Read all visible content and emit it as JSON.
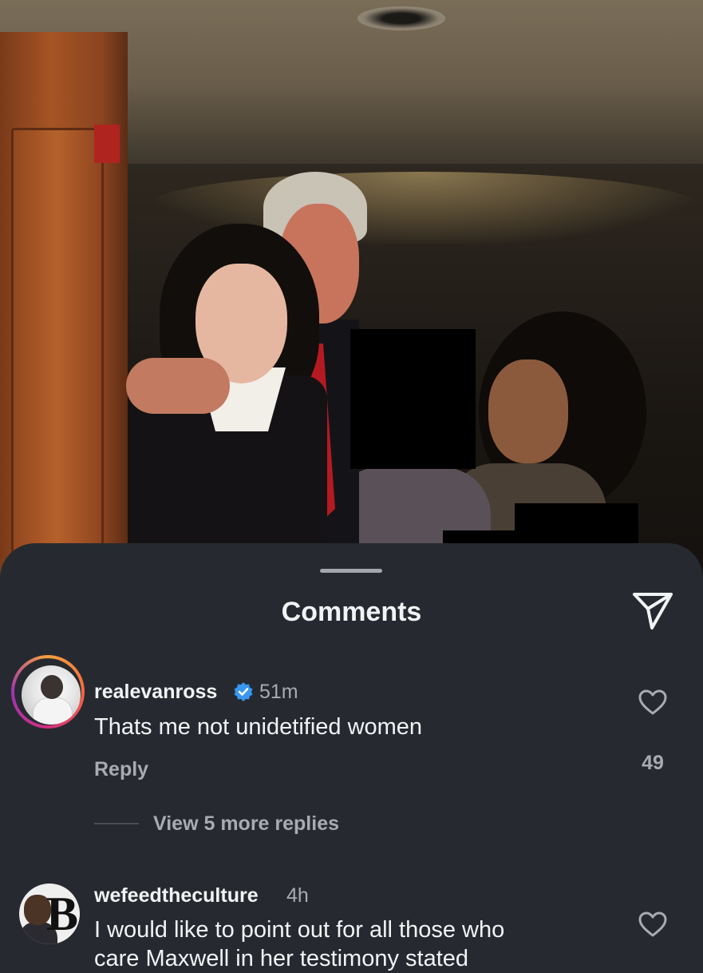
{
  "sheet": {
    "title": "Comments"
  },
  "comments": [
    {
      "username": "realevanross",
      "verified": true,
      "time": "51m",
      "text": "Thats me not unidetified women",
      "reply_label": "Reply",
      "likes": "49",
      "view_replies": "View 5 more replies",
      "avatar_story_ring": true
    },
    {
      "username": "wefeedtheculture",
      "time": "4h",
      "text_line1": "I would like to point out for all those who",
      "text_line2": "care Maxwell in her testimony stated"
    }
  ],
  "icons": {
    "share": "paper-plane-icon",
    "like": "heart-outline-icon",
    "verified": "verified-badge-icon"
  },
  "colors": {
    "sheet_background": "#262a30",
    "primary_text": "#f2f3f5",
    "secondary_text": "#a8abb0",
    "verified_blue": "#3897f0"
  }
}
